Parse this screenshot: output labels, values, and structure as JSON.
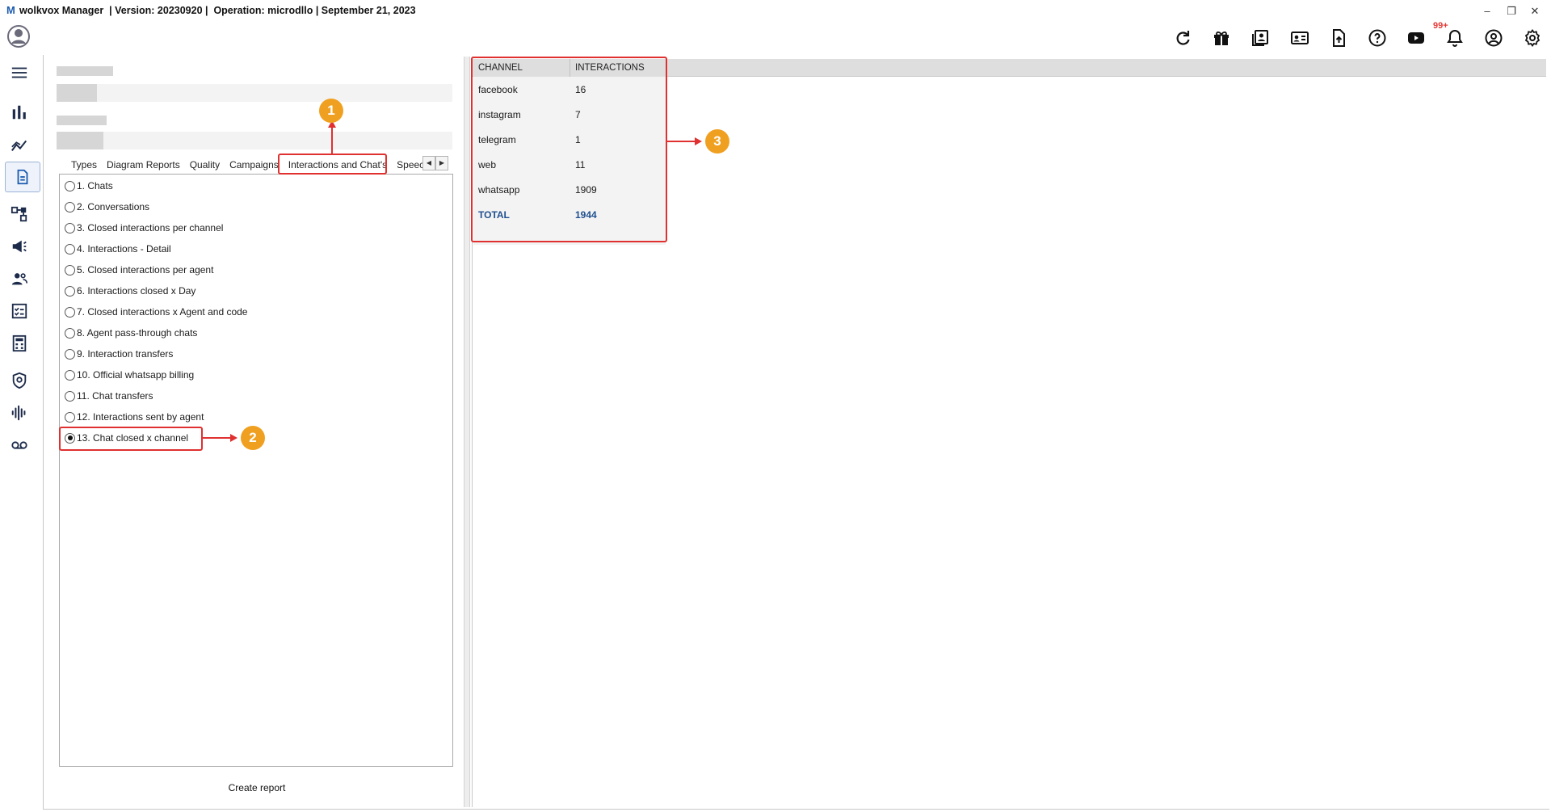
{
  "window": {
    "logo_letter": "M",
    "title": "wolkvox Manager  | Version: 20230920 |  Operation: microdllo | September 21, 2023",
    "minimize": "–",
    "restore": "❐",
    "close": "✕"
  },
  "toolbar": {
    "notification_count": "99+",
    "icons": [
      "refresh-icon",
      "gift-icon",
      "contacts-book-icon",
      "id-card-icon",
      "upload-file-icon",
      "help-icon",
      "youtube-icon",
      "bell-icon",
      "account-icon",
      "settings-icon"
    ]
  },
  "sidebar": {
    "icons": [
      "menu-icon",
      "bar-chart-icon",
      "trend-chart-icon",
      "reports-icon",
      "flow-icon",
      "campaign-icon",
      "team-icon",
      "checklist-icon",
      "calculator-icon",
      "shield-icon",
      "audio-wave-icon",
      "voicemail-icon"
    ]
  },
  "tabs": [
    {
      "label": "Types"
    },
    {
      "label": "Diagram Reports"
    },
    {
      "label": "Quality"
    },
    {
      "label": "Campaigns"
    },
    {
      "label": "Interactions and Chat's"
    },
    {
      "label": "Speech"
    }
  ],
  "reports": [
    {
      "label": "1. Chats",
      "selected": false
    },
    {
      "label": "2. Conversations",
      "selected": false
    },
    {
      "label": "3. Closed interactions per channel",
      "selected": false
    },
    {
      "label": "4. Interactions - Detail",
      "selected": false
    },
    {
      "label": "5. Closed interactions per agent",
      "selected": false
    },
    {
      "label": "6. Interactions closed x Day",
      "selected": false
    },
    {
      "label": "7. Closed interactions x Agent and code",
      "selected": false
    },
    {
      "label": "8. Agent pass-through chats",
      "selected": false
    },
    {
      "label": "9. Interaction transfers",
      "selected": false
    },
    {
      "label": "10. Official whatsapp billing",
      "selected": false
    },
    {
      "label": "11. Chat transfers",
      "selected": false
    },
    {
      "label": "12. Interactions sent by agent",
      "selected": false
    },
    {
      "label": "13. Chat closed x channel",
      "selected": true
    }
  ],
  "create_report": "Create report",
  "grid": {
    "headers": [
      "CHANNEL",
      "INTERACTIONS"
    ],
    "rows": [
      {
        "channel": "facebook",
        "interactions": "16"
      },
      {
        "channel": "instagram",
        "interactions": "7"
      },
      {
        "channel": "telegram",
        "interactions": "1"
      },
      {
        "channel": "web",
        "interactions": "11"
      },
      {
        "channel": "whatsapp",
        "interactions": "1909"
      }
    ],
    "total": {
      "channel": "TOTAL",
      "interactions": "1944"
    }
  },
  "annotations": {
    "marker_1": "1",
    "marker_2": "2",
    "marker_3": "3"
  },
  "colors": {
    "annotation_red": "#e03030",
    "marker_orange": "#f0a020",
    "total_blue": "#1f4f8f",
    "badge_red": "#e53935"
  }
}
